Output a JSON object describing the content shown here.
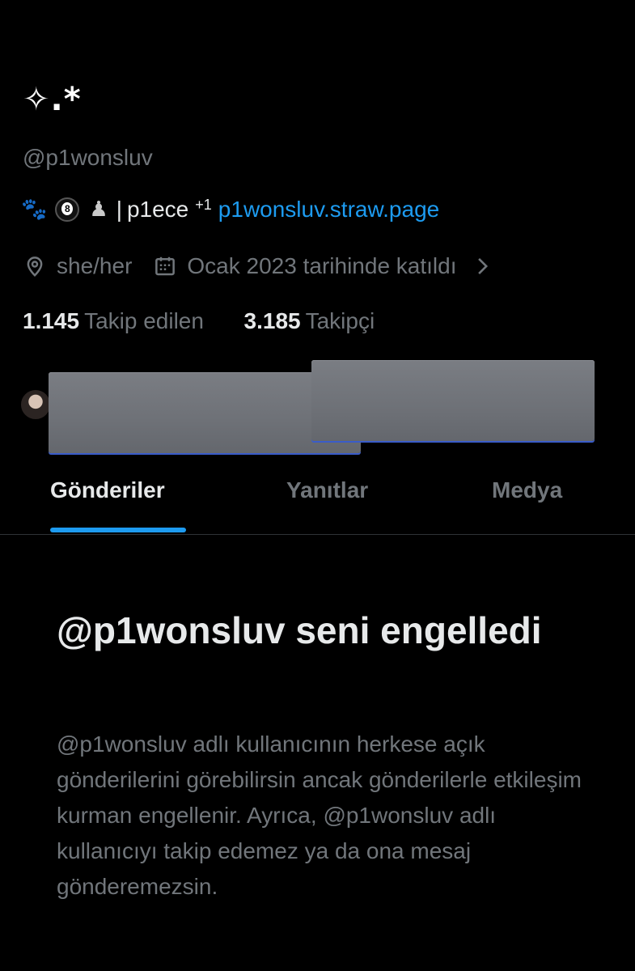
{
  "profile": {
    "display_name": "✧.*",
    "handle": "@p1wonsluv",
    "bio": {
      "emoji_paw": "🐾",
      "emoji_ball": "8-ball-icon",
      "emoji_pawn": "♟",
      "separator": "|",
      "text": "p1ece",
      "extra": "+1",
      "link": "p1wonsluv.straw.page"
    },
    "pronouns": "she/her",
    "joined": "Ocak 2023 tarihinde katıldı",
    "following_count": "1.145",
    "following_label": "Takip edilen",
    "followers_count": "3.185",
    "followers_label": "Takipçi"
  },
  "tabs": [
    {
      "label": "Gönderiler",
      "active": true
    },
    {
      "label": "Yanıtlar",
      "active": false
    },
    {
      "label": "Medya",
      "active": false
    }
  ],
  "blocked": {
    "title": "@p1wonsluv seni engelledi",
    "description": "@p1wonsluv adlı kullanıcının herkese açık gönderilerini görebilirsin ancak gönderilerle etkileşim kurman engellenir. Ayrıca, @p1wonsluv adlı kullanıcıyı takip edemez ya da ona mesaj gönderemezsin."
  },
  "colors": {
    "background": "#000000",
    "primary_text": "#e7e9ea",
    "secondary_text": "#71767b",
    "accent": "#1d9bf0",
    "divider": "#2f3336"
  }
}
